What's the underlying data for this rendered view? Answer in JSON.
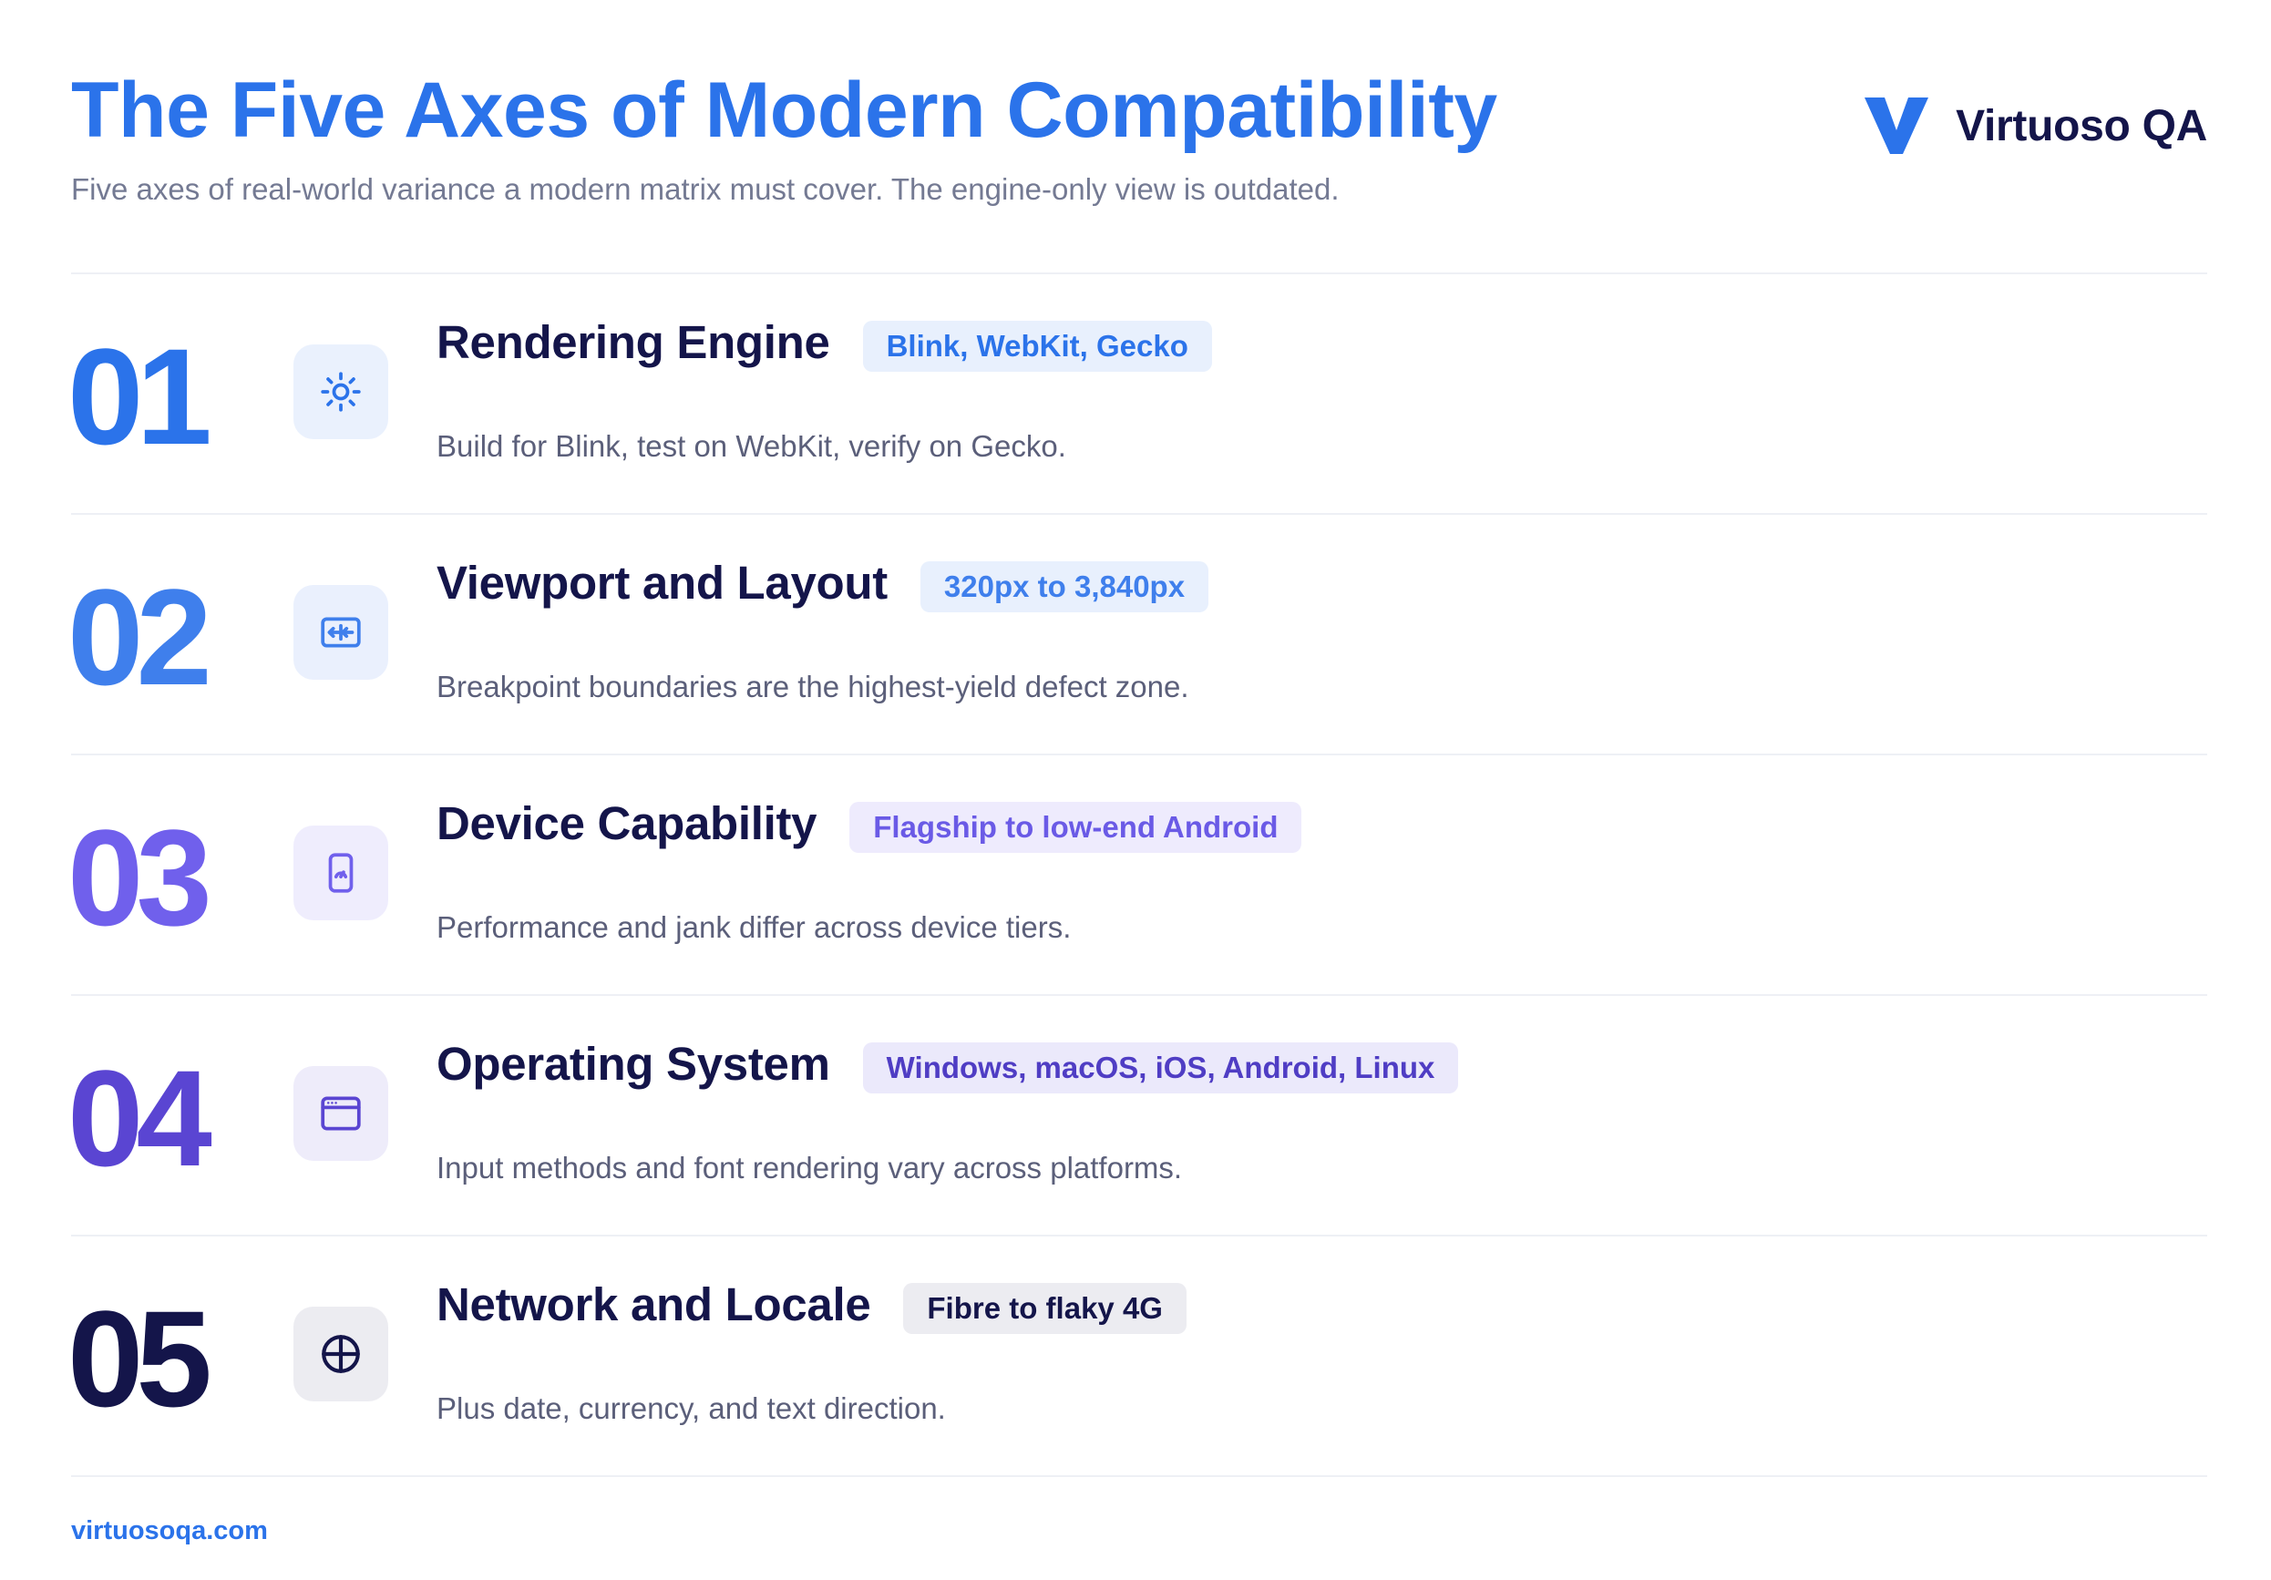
{
  "header": {
    "title": "The Five Axes of Modern Compatibility",
    "subtitle": "Five axes of real-world variance a modern matrix must cover. The engine-only view is outdated."
  },
  "brand": {
    "name": "Virtuoso QA",
    "logo_icon": "v-logo-icon",
    "color": "#2b73ea"
  },
  "axes": [
    {
      "number": "01",
      "title": "Rendering Engine",
      "tag": "Blink, WebKit, Gecko",
      "description": "Build for Blink, test on WebKit, verify on Gecko.",
      "icon": "sun-icon",
      "number_color": "#2b73ea",
      "icon_bg": "#eaf1fd",
      "icon_color": "#2b73ea",
      "tag_bg": "#e8f0fd",
      "tag_color": "#2b73ea"
    },
    {
      "number": "02",
      "title": "Viewport and Layout",
      "tag": "320px to 3,840px",
      "description": "Breakpoint boundaries are the highest-yield defect zone.",
      "icon": "viewport-resize-icon",
      "number_color": "#3f7fec",
      "icon_bg": "#eaf0fd",
      "icon_color": "#3f7fec",
      "tag_bg": "#e8f0fd",
      "tag_color": "#3f7fec"
    },
    {
      "number": "03",
      "title": "Device Capability",
      "tag": "Flagship to low-end Android",
      "description": "Performance and jank differ across device tiers.",
      "icon": "phone-gauge-icon",
      "number_color": "#7060ec",
      "icon_bg": "#efedfd",
      "icon_color": "#7060ec",
      "tag_bg": "#eeebfd",
      "tag_color": "#6a5ae6"
    },
    {
      "number": "04",
      "title": "Operating System",
      "tag": "Windows, macOS, iOS, Android, Linux",
      "description": "Input methods and font rendering vary across platforms.",
      "icon": "browser-window-icon",
      "number_color": "#5a45d2",
      "icon_bg": "#eeecfa",
      "icon_color": "#5a45d2",
      "tag_bg": "#ebe9fb",
      "tag_color": "#4f3dc4"
    },
    {
      "number": "05",
      "title": "Network and Locale",
      "tag": "Fibre to flaky 4G",
      "description": "Plus date, currency, and text direction.",
      "icon": "globe-icon",
      "number_color": "#14154a",
      "icon_bg": "#ececf1",
      "icon_color": "#14154a",
      "tag_bg": "#ececf1",
      "tag_color": "#14154a"
    }
  ],
  "footer": {
    "link": "virtuosoqa.com"
  }
}
